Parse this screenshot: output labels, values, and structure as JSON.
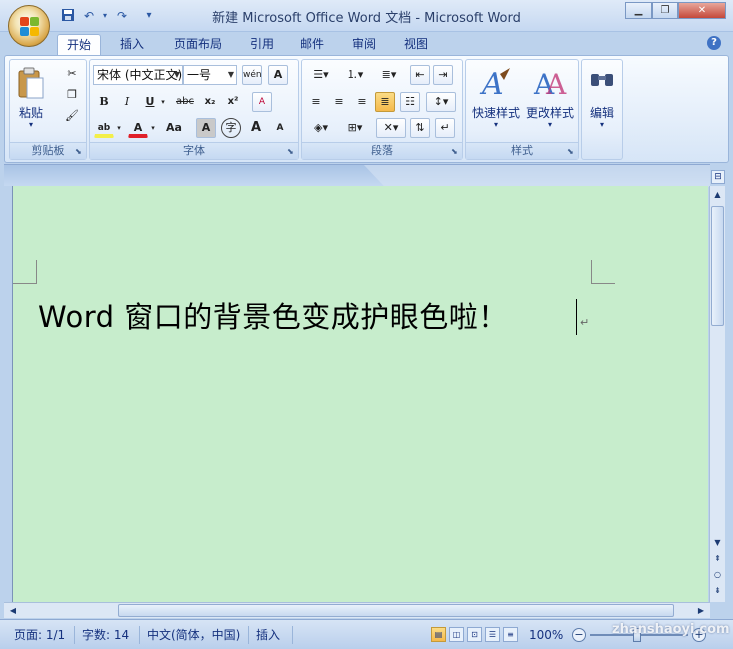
{
  "window": {
    "title": "新建 Microsoft Office Word 文档 - Microsoft Word",
    "minimize": "▁",
    "maximize": "❐",
    "close": "✕"
  },
  "quick_access": {
    "save_icon": "save-icon",
    "undo": "↶",
    "redo": "↷",
    "more": "▾"
  },
  "tabs": [
    {
      "label": "开始",
      "active": true
    },
    {
      "label": "插入"
    },
    {
      "label": "页面布局"
    },
    {
      "label": "引用"
    },
    {
      "label": "邮件"
    },
    {
      "label": "审阅"
    },
    {
      "label": "视图"
    }
  ],
  "help": "?",
  "clipboard": {
    "label": "剪贴板",
    "paste": "粘贴",
    "paste_arrow": "▾"
  },
  "font": {
    "label": "字体",
    "name": "宋体 (中文正文)",
    "size": "一号",
    "bold": "B",
    "italic": "I",
    "underline": "U",
    "strike": "abc",
    "subscript": "x₂",
    "superscript": "x²",
    "highlight": "ab",
    "color": "A",
    "case": "Aa",
    "shade": "A",
    "enclose": "字",
    "grow": "A",
    "shrink": "A",
    "phonetic": "wén",
    "border_char": "A",
    "clear": "A"
  },
  "paragraph": {
    "label": "段落"
  },
  "styles": {
    "label": "样式",
    "quick": "快速样式",
    "change": "更改样式"
  },
  "editing": {
    "label": "编辑"
  },
  "document": {
    "text": "Word 窗口的背景色变成护眼色啦！",
    "para_mark": "↵",
    "background_color": "#c7edcc"
  },
  "status": {
    "page": "页面: 1/1",
    "words": "字数: 14",
    "language": "中文(简体，中国)",
    "mode": "插入",
    "zoom": "100%",
    "zoom_out": "−",
    "zoom_in": "+",
    "watermark": "zhanshaoyi.com"
  },
  "colors": {
    "accent": "#15317e",
    "ribbon": "#dfeaf8",
    "highlight": "#f5b94b"
  }
}
